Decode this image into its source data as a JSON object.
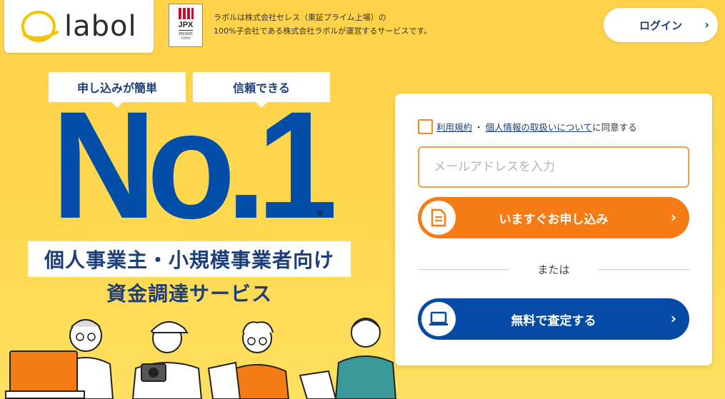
{
  "header": {
    "logo_text": "labol",
    "jpx": {
      "main": "JPX",
      "sub": "PRIME",
      "sub2": "TOKYO"
    },
    "note_line1": "ラボルは株式会社セレス（東証プライム上場）の",
    "note_line2": "100%子会社である株式会社ラボルが運営するサービスです。",
    "login_label": "ログイン"
  },
  "hero": {
    "tag1": "申し込みが簡単",
    "tag2": "信頼できる",
    "headline": "No.1",
    "note_mark": "※",
    "tagline1": "個人事業主・小規模事業者向け",
    "tagline2": "資金調達サービス"
  },
  "form": {
    "terms_link": "利用規約",
    "separator": "・",
    "privacy_link": "個人情報の取扱いについて",
    "agree_suffix": "に同意する",
    "email_placeholder": "メールアドレスを入力",
    "apply_label": "いますぐお申し込み",
    "or_text": "または",
    "assess_label": "無料で査定する"
  },
  "colors": {
    "brand_yellow": "#ffd24a",
    "brand_blue": "#004ea8",
    "apply_orange": "#f57c14",
    "assess_blue": "#054aa5"
  }
}
